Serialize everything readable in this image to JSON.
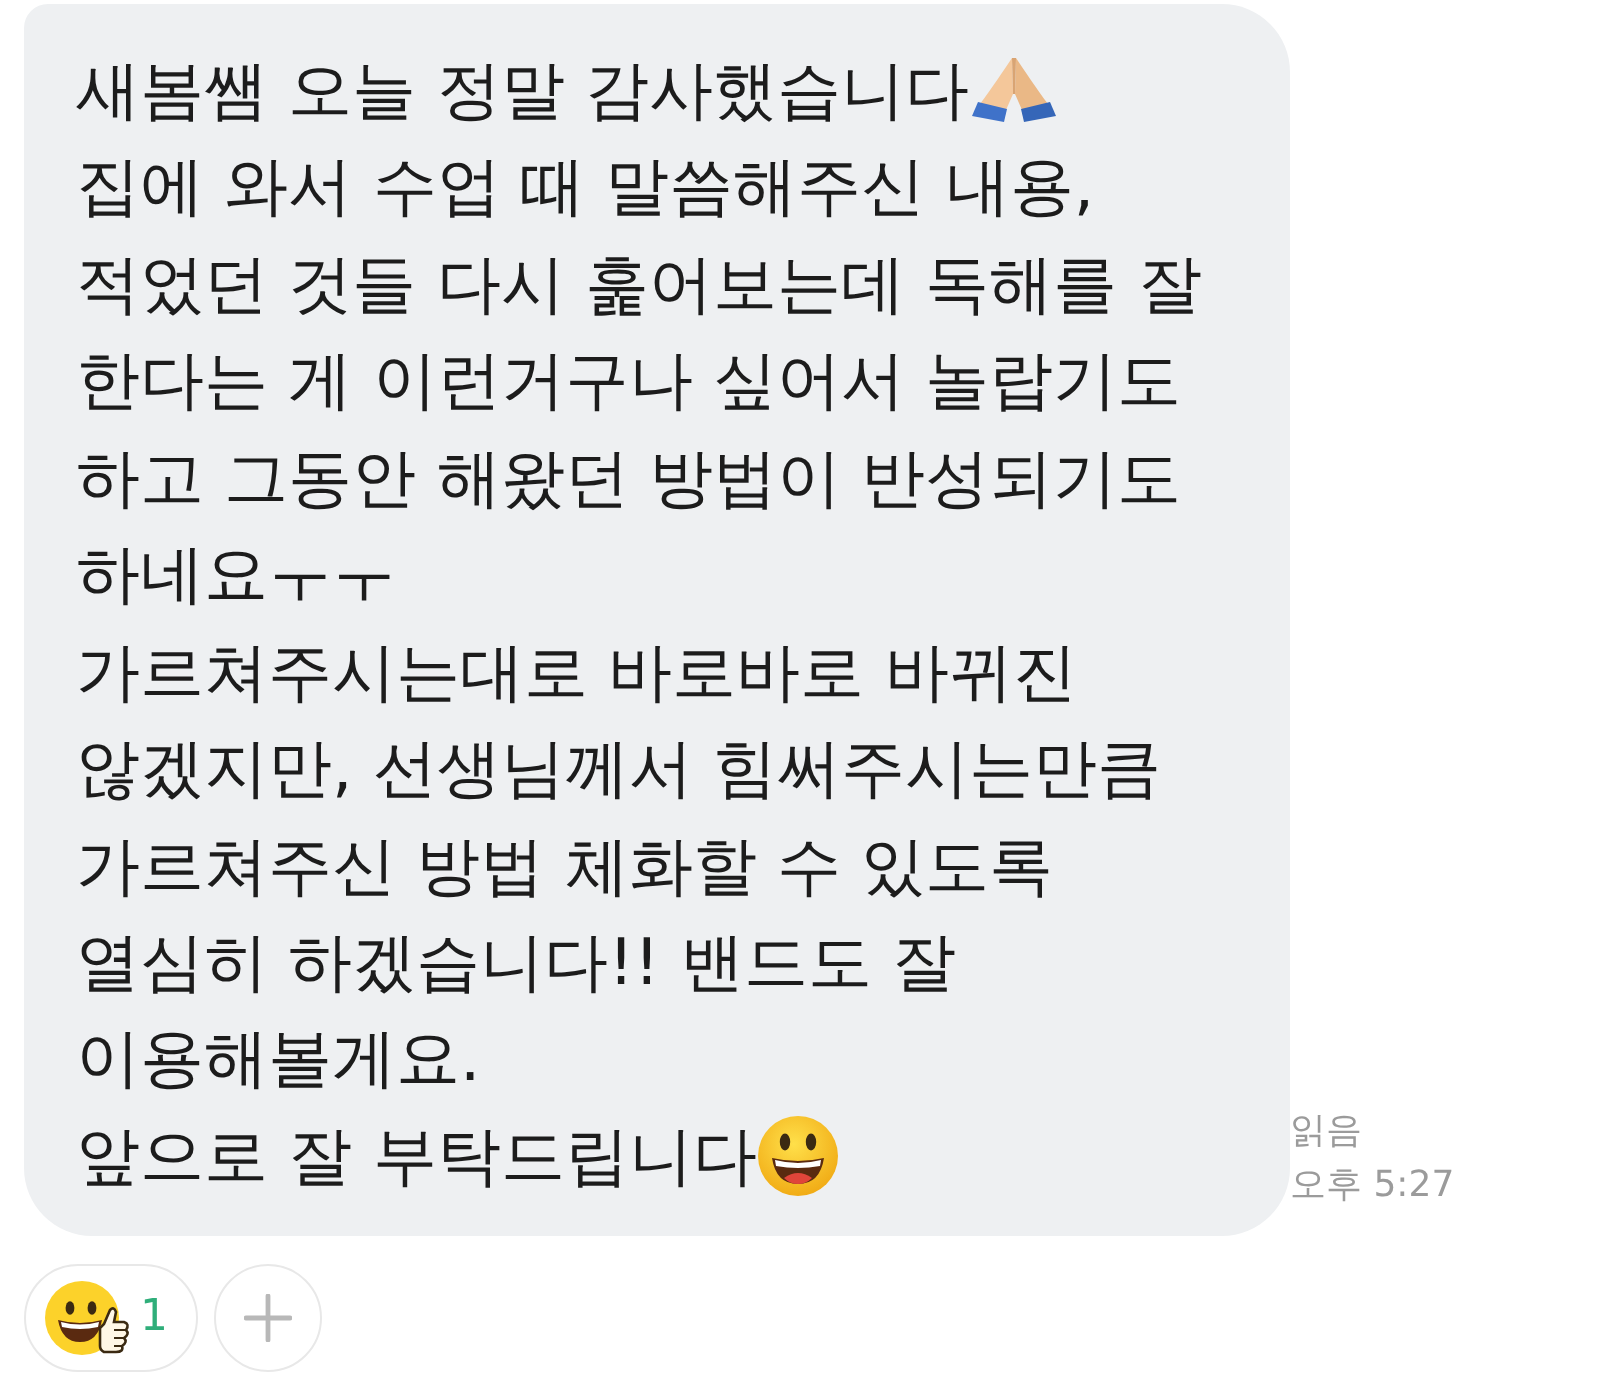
{
  "message": {
    "lines": [
      {
        "kind": "folded-hands",
        "text": "새봄쌤 오늘 정말 감사했습니다"
      },
      {
        "kind": "plain",
        "text": "집에 와서 수업 때 말씀해주신 내용,"
      },
      {
        "kind": "plain",
        "text": "적었던 것들 다시 훑어보는데 독해를 잘"
      },
      {
        "kind": "plain",
        "text": "한다는 게 이런거구나 싶어서 놀랍기도"
      },
      {
        "kind": "plain",
        "text": "하고 그동안 해왔던 방법이 반성되기도"
      },
      {
        "kind": "plain",
        "text": "하네요ㅜㅜ"
      },
      {
        "kind": "plain",
        "text": "가르쳐주시는대로 바로바로 바뀌진"
      },
      {
        "kind": "plain",
        "text": "않겠지만, 선생님께서 힘써주시는만큼"
      },
      {
        "kind": "plain",
        "text": "가르쳐주신 방법 체화할 수 있도록"
      },
      {
        "kind": "plain",
        "text": "열심히 하겠습니다!! 밴드도 잘"
      },
      {
        "kind": "plain",
        "text": "이용해볼게요."
      },
      {
        "kind": "grinning-face",
        "text": "앞으로 잘 부탁드립니다"
      }
    ],
    "read_label": "읽음",
    "time": "오후 5:27"
  },
  "reactions": [
    {
      "count": "1",
      "selected": true
    }
  ]
}
